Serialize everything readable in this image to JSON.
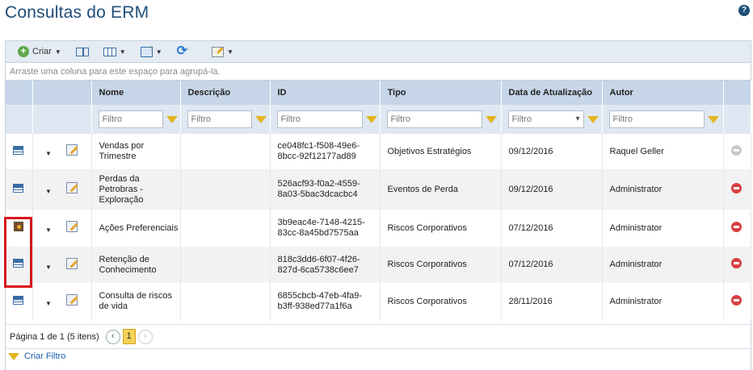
{
  "page": {
    "title": "Consultas do ERM",
    "help_icon": "?"
  },
  "toolbar": {
    "create_label": "Criar"
  },
  "groupbar": {
    "hint": "Arraste uma coluna para este espaço para agrupá-la."
  },
  "columns": [
    "Nome",
    "Descrição",
    "ID",
    "Tipo",
    "Data de Atualização",
    "Autor"
  ],
  "filter_placeholder": "Filtro",
  "rows": [
    {
      "icon": "grid-icon",
      "name": "Vendas por Trimestre",
      "description": "",
      "id": "ce048fc1-f508-49e6-8bcc-92f12177ad89",
      "type": "Objetivos Estratégios",
      "date": "09/12/2016",
      "author": "Raquel Geller",
      "delete_enabled": false
    },
    {
      "icon": "grid-icon",
      "name": "Perdas da Petrobras - Exploração",
      "description": "",
      "id": "526acf93-f0a2-4559-8a03-5bac3dcacbc4",
      "type": "Eventos de Perda",
      "date": "09/12/2016",
      "author": "Administrator",
      "delete_enabled": true
    },
    {
      "icon": "chart-icon",
      "name": "Ações Preferenciais",
      "description": "",
      "id": "3b9eac4e-7148-4215-83cc-8a45bd7575aa",
      "type": "Riscos Corporativos",
      "date": "07/12/2016",
      "author": "Administrator",
      "delete_enabled": true
    },
    {
      "icon": "grid-icon",
      "name": "Retenção de Conhecimento",
      "description": "",
      "id": "818c3dd6-6f07-4f26-827d-6ca5738c6ee7",
      "type": "Riscos Corporativos",
      "date": "07/12/2016",
      "author": "Administrator",
      "delete_enabled": true
    },
    {
      "icon": "grid-icon",
      "name": "Consulta de riscos de vida",
      "description": "",
      "id": "6855cbcb-47eb-4fa9-b3ff-938ed77a1f6a",
      "type": "Riscos Corporativos",
      "date": "28/11/2016",
      "author": "Administrator",
      "delete_enabled": true
    }
  ],
  "pager": {
    "text": "Página 1 de 1 (5 itens)",
    "prev": "‹",
    "next": "›",
    "current_page": "1"
  },
  "footer": {
    "create_filter": "Criar Filtro"
  },
  "colors": {
    "title": "#1f4e79",
    "header": "#c6d6e8",
    "filter_row": "#dfe8f2",
    "highlight": "#d9141b",
    "delete": "#d94040"
  }
}
